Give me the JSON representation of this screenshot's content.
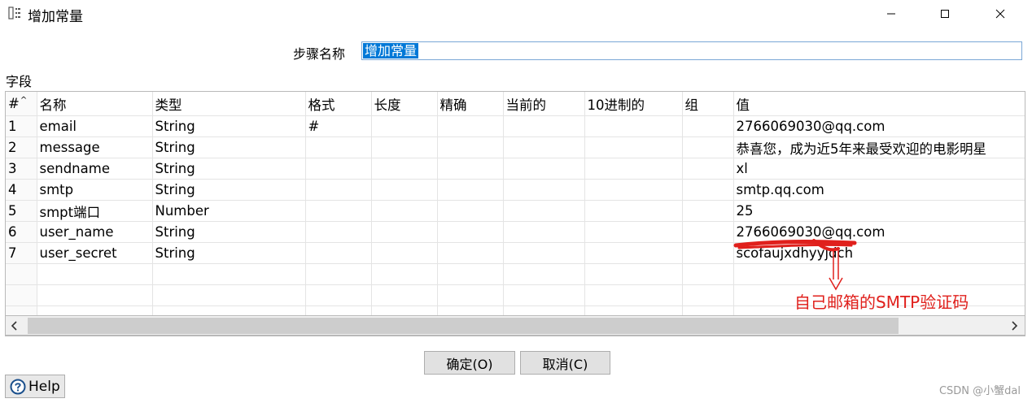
{
  "window": {
    "title": "增加常量",
    "controls": {
      "minimize": "minimize-icon",
      "maximize": "maximize-icon",
      "close": "close-icon"
    }
  },
  "step": {
    "label": "步骤名称",
    "value": "增加常量"
  },
  "fields": {
    "label": "字段",
    "columns": [
      "#",
      "名称",
      "类型",
      "格式",
      "长度",
      "精确",
      "当前的",
      "10进制的",
      "组",
      "值"
    ],
    "rows": [
      {
        "num": "1",
        "name": "email",
        "type": "String",
        "format": "#",
        "length": "",
        "precision": "",
        "currency": "",
        "decimal": "",
        "group": "",
        "value": "2766069030@qq.com"
      },
      {
        "num": "2",
        "name": "message",
        "type": "String",
        "format": "",
        "length": "",
        "precision": "",
        "currency": "",
        "decimal": "",
        "group": "",
        "value": "恭喜您，成为近5年来最受欢迎的电影明星"
      },
      {
        "num": "3",
        "name": "sendname",
        "type": "String",
        "format": "",
        "length": "",
        "precision": "",
        "currency": "",
        "decimal": "",
        "group": "",
        "value": "xl"
      },
      {
        "num": "4",
        "name": "smtp",
        "type": "String",
        "format": "",
        "length": "",
        "precision": "",
        "currency": "",
        "decimal": "",
        "group": "",
        "value": "smtp.qq.com"
      },
      {
        "num": "5",
        "name": "smpt端口",
        "type": "Number",
        "format": "",
        "length": "",
        "precision": "",
        "currency": "",
        "decimal": "",
        "group": "",
        "value": "25"
      },
      {
        "num": "6",
        "name": "user_name",
        "type": "String",
        "format": "",
        "length": "",
        "precision": "",
        "currency": "",
        "decimal": "",
        "group": "",
        "value": "2766069030@qq.com"
      },
      {
        "num": "7",
        "name": "user_secret",
        "type": "String",
        "format": "",
        "length": "",
        "precision": "",
        "currency": "",
        "decimal": "",
        "group": "",
        "value": "scofaujxdhyyjdch"
      }
    ],
    "empty_rows": 3
  },
  "annotation": {
    "text": "自己邮箱的SMTP验证码",
    "color": "#e0201c"
  },
  "buttons": {
    "ok": "确定(O)",
    "cancel": "取消(C)",
    "help": "Help"
  },
  "watermark": "CSDN @小蟹dal",
  "colors": {
    "selection": "#0078d7",
    "annotation": "#e0201c",
    "button_bg": "#e1e1e1"
  }
}
